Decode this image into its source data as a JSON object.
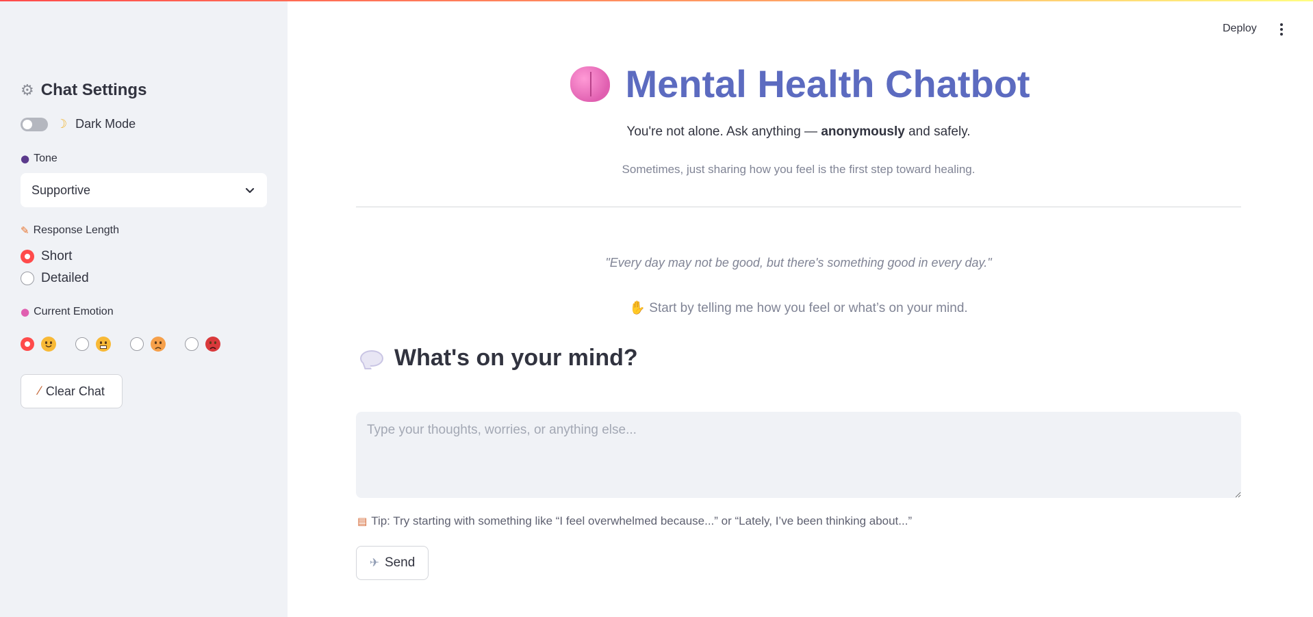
{
  "header": {
    "deploy_label": "Deploy"
  },
  "sidebar": {
    "title": "Chat Settings",
    "title_icon": "gear-icon",
    "dark_mode": {
      "label": "Dark Mode",
      "icon": "crescent-moon-icon",
      "checked": false
    },
    "tone": {
      "label": "Tone",
      "icon": "speaking-head-icon",
      "selected": "Supportive"
    },
    "response_length": {
      "label": "Response Length",
      "icon": "pencil-icon",
      "options": [
        {
          "label": "Short",
          "checked": true
        },
        {
          "label": "Detailed",
          "checked": false
        }
      ]
    },
    "emotion": {
      "label": "Current Emotion",
      "icon": "brain-icon",
      "options": [
        {
          "icon": "smiling-face-icon",
          "checked": true
        },
        {
          "icon": "grimacing-face-icon",
          "checked": false
        },
        {
          "icon": "flushed-face-icon",
          "checked": false
        },
        {
          "icon": "angry-face-icon",
          "checked": false
        }
      ]
    },
    "clear_button": {
      "label": "Clear Chat",
      "icon": "broom-icon"
    }
  },
  "main": {
    "title": "Mental Health Chatbot",
    "title_icon": "brain-icon",
    "subtitle_prefix": "You're not alone. Ask anything — ",
    "subtitle_bold": "anonymously",
    "subtitle_suffix": " and safely.",
    "tagline": "Sometimes, just sharing how you feel is the first step toward healing.",
    "quote": "\"Every day may not be good, but there's something good in every day.\"",
    "start_text": "Start by telling me how you feel or what’s on your mind.",
    "start_icon": "waving-hand-icon",
    "section_heading": "What's on your mind?",
    "section_icon": "speech-bubble-icon",
    "input": {
      "value": "",
      "placeholder": "Type your thoughts, worries, or anything else..."
    },
    "tip": "Tip: Try starting with something like “I feel overwhelmed because...” or “Lately, I’ve been thinking about...”",
    "tip_icon": "memo-icon",
    "send_button": {
      "label": "Send",
      "icon": "dove-icon"
    }
  },
  "colors": {
    "accent": "#ff4b4b",
    "title": "#5c6bc0",
    "sidebar_bg": "#f0f2f6"
  }
}
